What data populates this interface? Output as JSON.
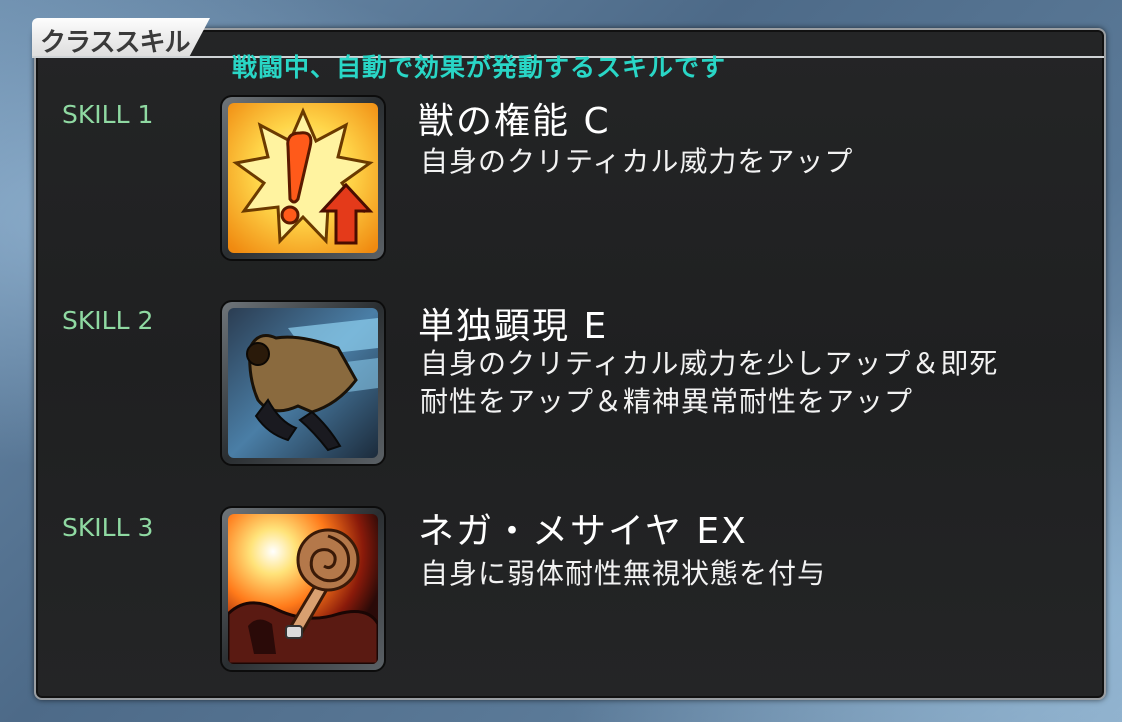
{
  "header": {
    "title": "クラススキル",
    "subtitle": "戦闘中、自動で効果が発動するスキルです"
  },
  "skills": [
    {
      "label": "SKILL 1",
      "name": "獣の権能 C",
      "description": "自身のクリティカル威力をアップ",
      "icon": "critical-up-icon"
    },
    {
      "label": "SKILL 2",
      "name": "単独顕現 E",
      "description_lines": [
        "自身のクリティカル威力を少しアップ＆即死",
        "耐性をアップ＆精神異常耐性をアップ"
      ],
      "icon": "independent-manifestation-icon"
    },
    {
      "label": "SKILL 3",
      "name": "ネガ・メサイヤ EX",
      "description": "自身に弱体耐性無視状態を付与",
      "icon": "nega-messiah-icon"
    }
  ],
  "colors": {
    "subtitle": "#29d6c6",
    "skill_label": "#8fd9a2",
    "panel": "#222324"
  }
}
